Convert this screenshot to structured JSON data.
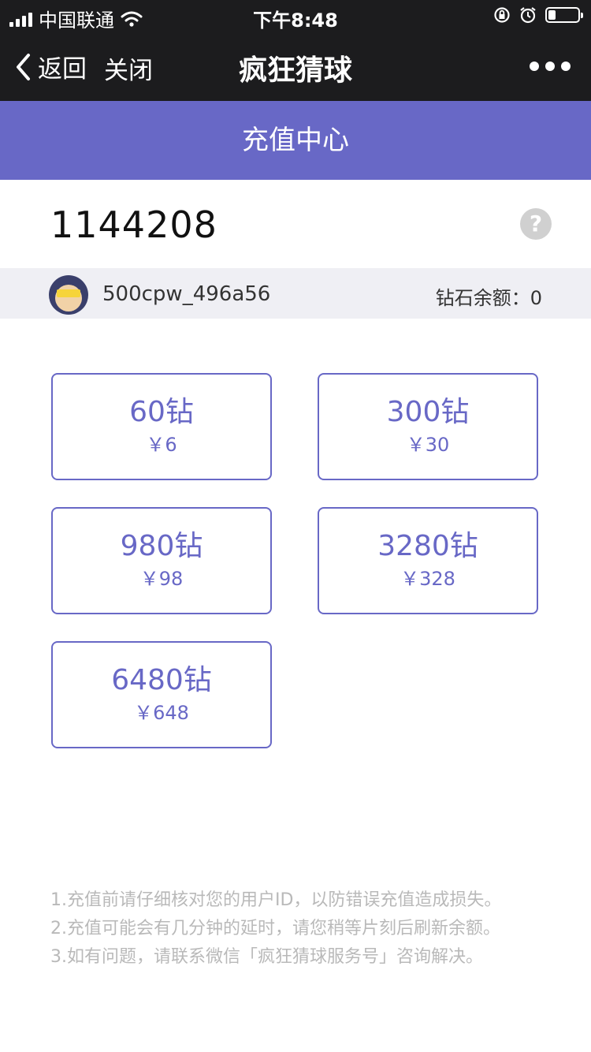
{
  "status_bar": {
    "carrier": "中国联通",
    "time": "下午8:48",
    "signal_icon": "signal-icon",
    "wifi_icon": "wifi-icon",
    "battery_level": 0.25
  },
  "nav": {
    "back_label": "返回",
    "close_label": "关闭",
    "title": "疯狂猜球"
  },
  "header": {
    "title": "充值中心"
  },
  "user": {
    "id": "1144208",
    "help_glyph": "?",
    "account_name": "500cpw_496a56",
    "balance_label": "钻石余额：",
    "balance_value": "0"
  },
  "packages": [
    {
      "amount": "60钻",
      "price": "￥6"
    },
    {
      "amount": "300钻",
      "price": "￥30"
    },
    {
      "amount": "980钻",
      "price": "￥98"
    },
    {
      "amount": "3280钻",
      "price": "￥328"
    },
    {
      "amount": "6480钻",
      "price": "￥648"
    }
  ],
  "notes": [
    "1.充值前请仔细核对您的用户ID，以防错误充值造成损失。",
    "2.充值可能会有几分钟的延时，请您稍等片刻后刷新余额。",
    "3.如有问题，请联系微信「疯狂猜球服务号」咨询解决。"
  ],
  "colors": {
    "accent": "#6868c6",
    "topbar": "#1c1c1e",
    "account_bg": "#efeff4",
    "note_text": "#b9b9b9"
  }
}
